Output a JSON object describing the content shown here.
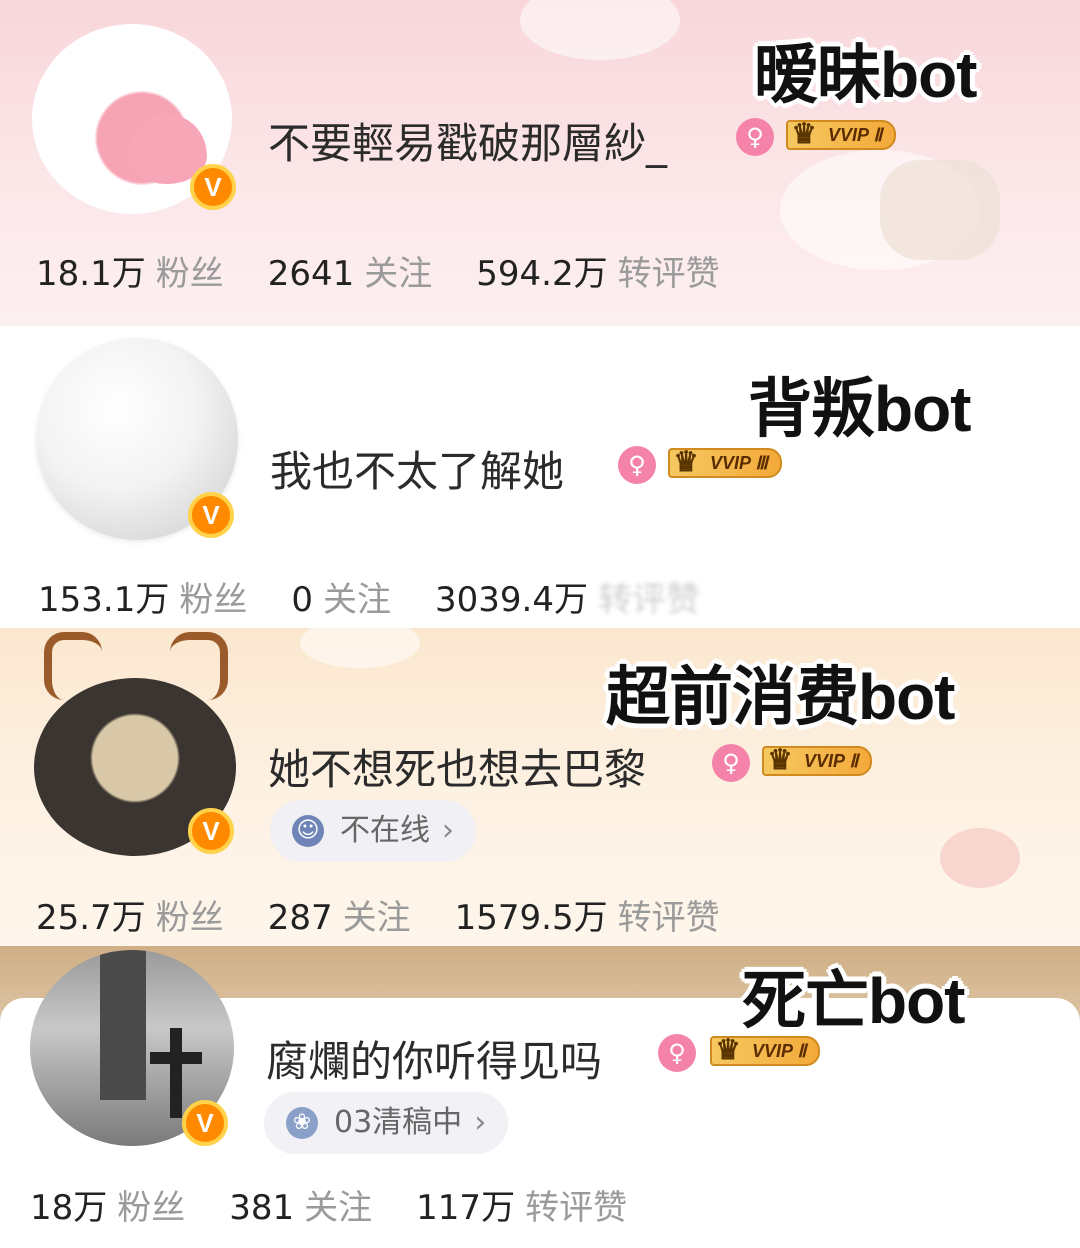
{
  "cards": [
    {
      "label": "暧昧bot",
      "name": "不要輕易戳破那層紗_",
      "vip_badge": "VVIP Ⅱ",
      "stats": {
        "fans_count": "18.1万",
        "fans_label": "粉丝",
        "follow_count": "2641",
        "follow_label": "关注",
        "likes_count": "594.2万",
        "likes_label": "转评赞"
      }
    },
    {
      "label": "背叛bot",
      "name": "我也不太了解她",
      "vip_badge": "VVIP Ⅲ",
      "stats": {
        "fans_count": "153.1万",
        "fans_label": "粉丝",
        "follow_count": "0",
        "follow_label": "关注",
        "likes_count": "3039.4万",
        "likes_label": "转评赞"
      }
    },
    {
      "label": "超前消费bot",
      "name": "她不想死也想去巴黎",
      "vip_badge": "VVIP Ⅱ",
      "status": "不在线",
      "stats": {
        "fans_count": "25.7万",
        "fans_label": "粉丝",
        "follow_count": "287",
        "follow_label": "关注",
        "likes_count": "1579.5万",
        "likes_label": "转评赞"
      }
    },
    {
      "label": "死亡bot",
      "name": "腐爛的你听得见吗",
      "vip_badge": "VVIP Ⅱ",
      "status": "03清稿中",
      "stats": {
        "fans_count": "18万",
        "fans_label": "粉丝",
        "follow_count": "381",
        "follow_label": "关注",
        "likes_count": "117万",
        "likes_label": "转评赞"
      }
    }
  ],
  "icons": {
    "verified": "V",
    "gender": "♀",
    "crown": "♛",
    "chevron": "›",
    "status_face": "☺",
    "status_flower": "❀"
  },
  "colors": {
    "card1_bg": "#f8d6da",
    "card3_bg": "#fbe7cf",
    "card4_bg": "#cfae85",
    "verified_badge": "#ff8a00",
    "gender_badge": "#f582a8",
    "vip_gold": "#f3a93a"
  }
}
